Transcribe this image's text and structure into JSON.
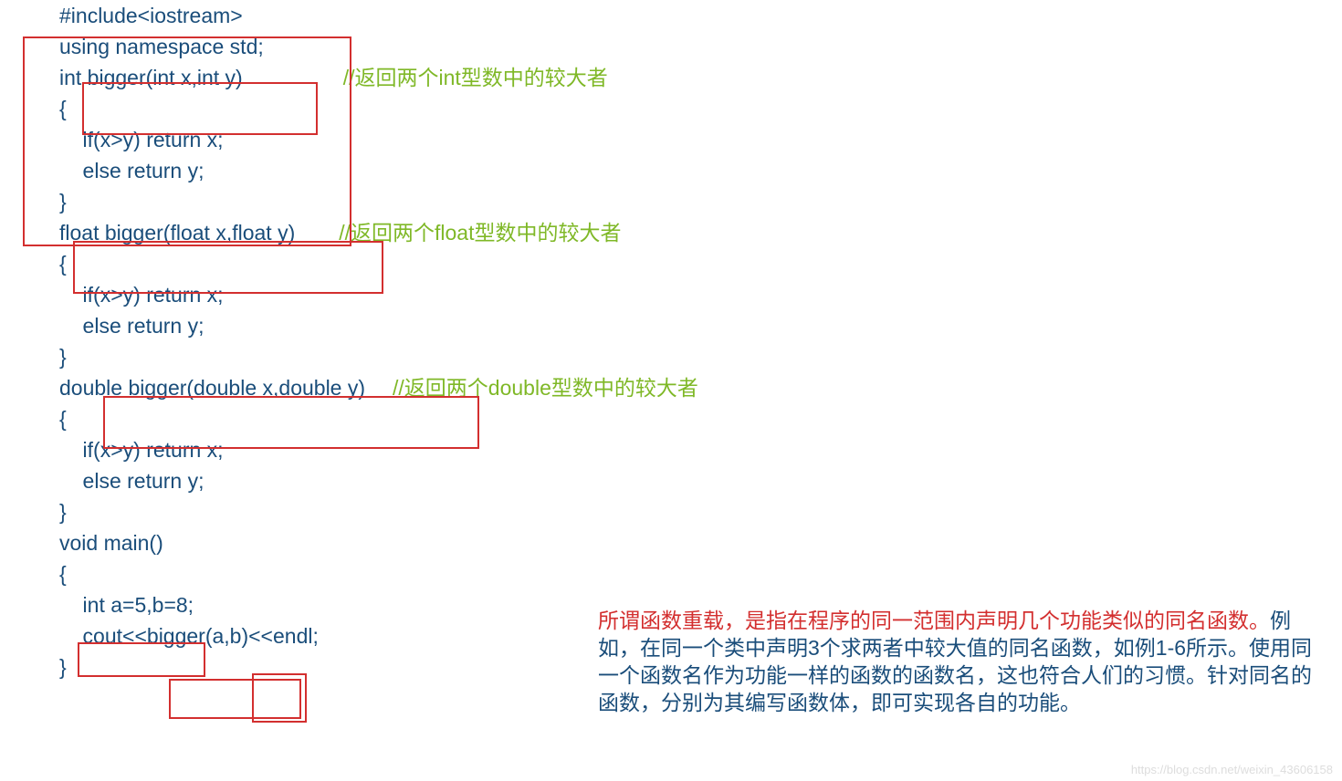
{
  "code": {
    "l1": "#include<iostream>",
    "l2": "using namespace std;",
    "l3": "",
    "l4": "int bigger(int x,int y)",
    "l4c": "//返回两个int型数中的较大者",
    "l5": "{",
    "l6": "    if(x>y) return x;",
    "l7": "    else return y;",
    "l8": "}",
    "l9": "float bigger(float x,float y)",
    "l9c": "//返回两个float型数中的较大者",
    "l10": "{",
    "l11": "    if(x>y) return x;",
    "l12": "    else return y;",
    "l13": "}",
    "l14": "double bigger(double x,double y)",
    "l14c": "//返回两个double型数中的较大者",
    "l15": "{",
    "l16": "    if(x>y) return x;",
    "l17": "    else return y;",
    "l18": "}",
    "l19": "",
    "l20": "void main()",
    "l21": "{",
    "l22": "    int a=5,b=8;",
    "l23": "    cout<<bigger(a,b)<<endl;",
    "l24": "}"
  },
  "explanation": {
    "red": "所谓函数重载，是指在程序的同一范围内声明几个功能类似的同名函数。",
    "rest": "例如，在同一个类中声明3个求两者中较大值的同名函数，如例1-6所示。使用同一个函数名作为功能一样的函数的函数名，这也符合人们的习惯。针对同名的函数，分别为其编写函数体，即可实现各自的功能。"
  },
  "watermark": "https://blog.csdn.net/weixin_43606158"
}
